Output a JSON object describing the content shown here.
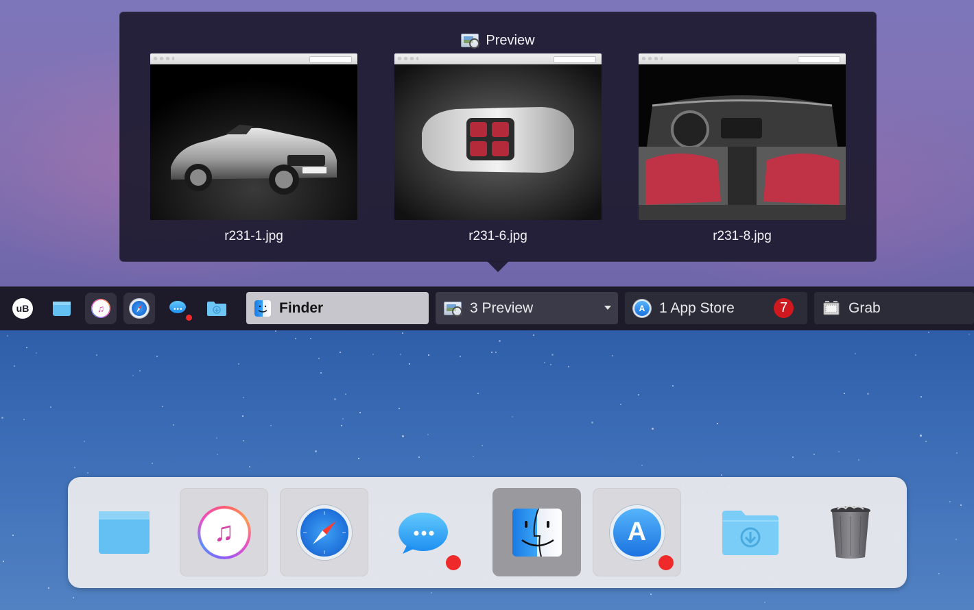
{
  "popover": {
    "app_title": "Preview",
    "windows": [
      {
        "label": "r231-1.jpg"
      },
      {
        "label": "r231-6.jpg"
      },
      {
        "label": "r231-8.jpg"
      }
    ]
  },
  "taskbar": {
    "quick_launch": [
      {
        "icon": "ublock-icon",
        "text": "uB"
      },
      {
        "icon": "window-icon"
      },
      {
        "icon": "itunes-icon"
      },
      {
        "icon": "safari-icon"
      },
      {
        "icon": "messages-icon"
      },
      {
        "icon": "downloads-folder-icon"
      }
    ],
    "apps": [
      {
        "label": "Finder",
        "icon": "finder-icon"
      },
      {
        "label": "3 Preview",
        "icon": "preview-icon"
      },
      {
        "label": "1 App Store",
        "icon": "app-store-icon",
        "badge": "7"
      },
      {
        "label": "Grab",
        "icon": "grab-icon"
      }
    ]
  },
  "dock": {
    "items": [
      {
        "icon": "window-icon"
      },
      {
        "icon": "itunes-icon"
      },
      {
        "icon": "safari-icon"
      },
      {
        "icon": "messages-icon"
      },
      {
        "icon": "finder-icon"
      },
      {
        "icon": "app-store-icon"
      },
      {
        "icon": "downloads-folder-icon"
      },
      {
        "icon": "trash-icon"
      }
    ]
  },
  "colors": {
    "badge": "#d0191e",
    "notification_dot": "#ef2a2a",
    "taskbar_bg": "#1d1b29",
    "active_button": "#c6c6cc"
  }
}
